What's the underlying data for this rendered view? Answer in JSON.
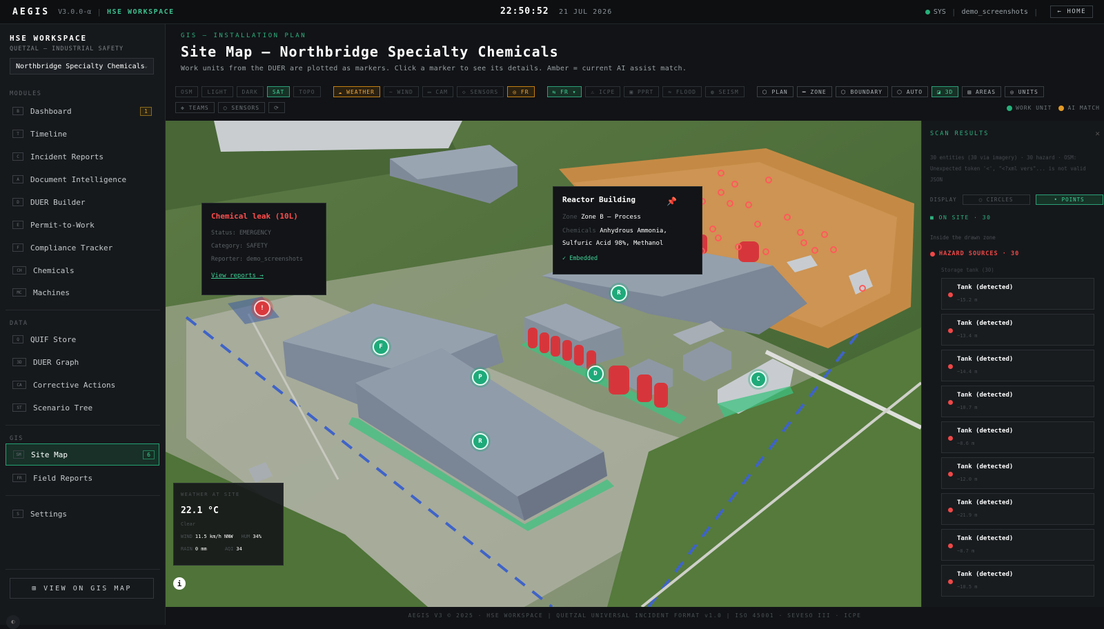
{
  "topbar": {
    "brand": "AEGIS",
    "version": "V3.0.0-α",
    "workspace": "HSE WORKSPACE",
    "time": "22:50:52",
    "date": "21 JUL 2026",
    "sys": "SYS",
    "user": "demo_screenshots",
    "home": "← HOME"
  },
  "sidebar": {
    "title": "HSE WORKSPACE",
    "subtitle": "QUETZAL — INDUSTRIAL SAFETY",
    "site": "Northbridge Specialty Chemicals",
    "sections": {
      "modules": "MODULES",
      "data": "DATA",
      "gis": "GIS"
    },
    "modules": [
      {
        "code": "B",
        "label": "Dashboard",
        "badge": "1"
      },
      {
        "code": "T",
        "label": "Timeline"
      },
      {
        "code": "C",
        "label": "Incident Reports"
      },
      {
        "code": "A",
        "label": "Document Intelligence"
      },
      {
        "code": "D",
        "label": "DUER Builder"
      },
      {
        "code": "E",
        "label": "Permit-to-Work"
      },
      {
        "code": "F",
        "label": "Compliance Tracker"
      },
      {
        "code": "CH",
        "label": "Chemicals"
      },
      {
        "code": "MC",
        "label": "Machines"
      }
    ],
    "data": [
      {
        "code": "Q",
        "label": "QUIF Store"
      },
      {
        "code": "3D",
        "label": "DUER Graph"
      },
      {
        "code": "CA",
        "label": "Corrective Actions"
      },
      {
        "code": "ST",
        "label": "Scenario Tree"
      }
    ],
    "gis": [
      {
        "code": "SM",
        "label": "Site Map",
        "badge": "6"
      },
      {
        "code": "FR",
        "label": "Field Reports"
      }
    ],
    "settings": {
      "code": "S",
      "label": "Settings"
    },
    "gis_button": "⊞ VIEW ON GIS MAP"
  },
  "main": {
    "eyebrow": "GIS — INSTALLATION PLAN",
    "title": "Site Map — Northbridge Specialty Chemicals",
    "subtitle": "Work units from the DUER are plotted as markers. Click a marker to see its details. Amber = current AI assist match."
  },
  "toolbar": {
    "row1a": [
      "OSM",
      "LIGHT",
      "DARK",
      "SAT",
      "TOPO"
    ],
    "row1b": [
      "☁ WEATHER",
      "~ WIND",
      "▭ CAM",
      "◇ SENSORS",
      "◎ FR"
    ],
    "row1c": [
      "⇆ FR ▾",
      "⚠ ICPE",
      "▣ PPRT",
      "≈ FLOOD",
      "◍ SEISM"
    ],
    "row1d": [
      "⬡ PLAN",
      "━ ZONE",
      "⬡ BOUNDARY",
      "⬡ AUTO",
      "◪ 3D",
      "▤ AREAS",
      "◎ UNITS"
    ],
    "row2": [
      "✥ TEAMS",
      "◯ SENSORS",
      "⟳"
    ]
  },
  "legend": {
    "work_unit": "WORK UNIT",
    "ai_match": "AI MATCH"
  },
  "colors": {
    "accent": "#26b07a",
    "amber": "#e39a25",
    "danger": "#e23c3f"
  },
  "markers": [
    "F",
    "P",
    "R",
    "R",
    "D",
    "C",
    "!"
  ],
  "incident_popup": {
    "title": "Chemical leak (10L)",
    "status": "Status: EMERGENCY",
    "category": "Category: SAFETY",
    "reporter": "Reporter: demo_screenshots",
    "link": "View reports →"
  },
  "unit_popup": {
    "title": "Reactor Building",
    "zone_key": "Zone",
    "zone": "Zone B — Process",
    "chem_key": "Chemicals",
    "chemicals": "Anhydrous Ammonia, Sulfuric Acid 98%, Methanol",
    "embedded": "✓ Embedded",
    "pin_icon": "pin-icon"
  },
  "weather": {
    "label": "WEATHER AT SITE",
    "temp": "22.1 °C",
    "condition": "Clear",
    "wind_key": "WIND",
    "wind": "11.5 km/h NNW",
    "hum_key": "HUM",
    "humidity": "34%",
    "rain_key": "RAIN",
    "rain": "0 mm",
    "aqi_key": "AQI",
    "aqi": "34"
  },
  "scan": {
    "title": "SCAN RESULTS",
    "meta1": "30 entities (30 via imagery) · 30 hazard · OSM:",
    "meta2": "Unexpected token '<', \"<?xml vers\"... is not valid",
    "meta3": "JSON",
    "display": "DISPLAY",
    "circles": "◯ CIRCLES",
    "points": "• POINTS",
    "onsite": "■ ON SITE · 30",
    "inzone": "Inside the drawn zone",
    "hazard": "HAZARD SOURCES · 30",
    "storage": "Storage tank (30)",
    "tanks": [
      {
        "name": "Tank (detected)",
        "size": "~15.2 m"
      },
      {
        "name": "Tank (detected)",
        "size": "~13.4 m"
      },
      {
        "name": "Tank (detected)",
        "size": "~14.4 m"
      },
      {
        "name": "Tank (detected)",
        "size": "~10.7 m"
      },
      {
        "name": "Tank (detected)",
        "size": "~8.6 m"
      },
      {
        "name": "Tank (detected)",
        "size": "~12.0 m"
      },
      {
        "name": "Tank (detected)",
        "size": "~21.9 m"
      },
      {
        "name": "Tank (detected)",
        "size": "~8.7 m"
      },
      {
        "name": "Tank (detected)",
        "size": "~10.5 m"
      }
    ]
  },
  "footer": "AEGIS V3 © 2025 · HSE WORKSPACE  |  QUETZAL UNIVERSAL INCIDENT FORMAT v1.0  |  ISO 45001 · SEVESO III · ICPE"
}
